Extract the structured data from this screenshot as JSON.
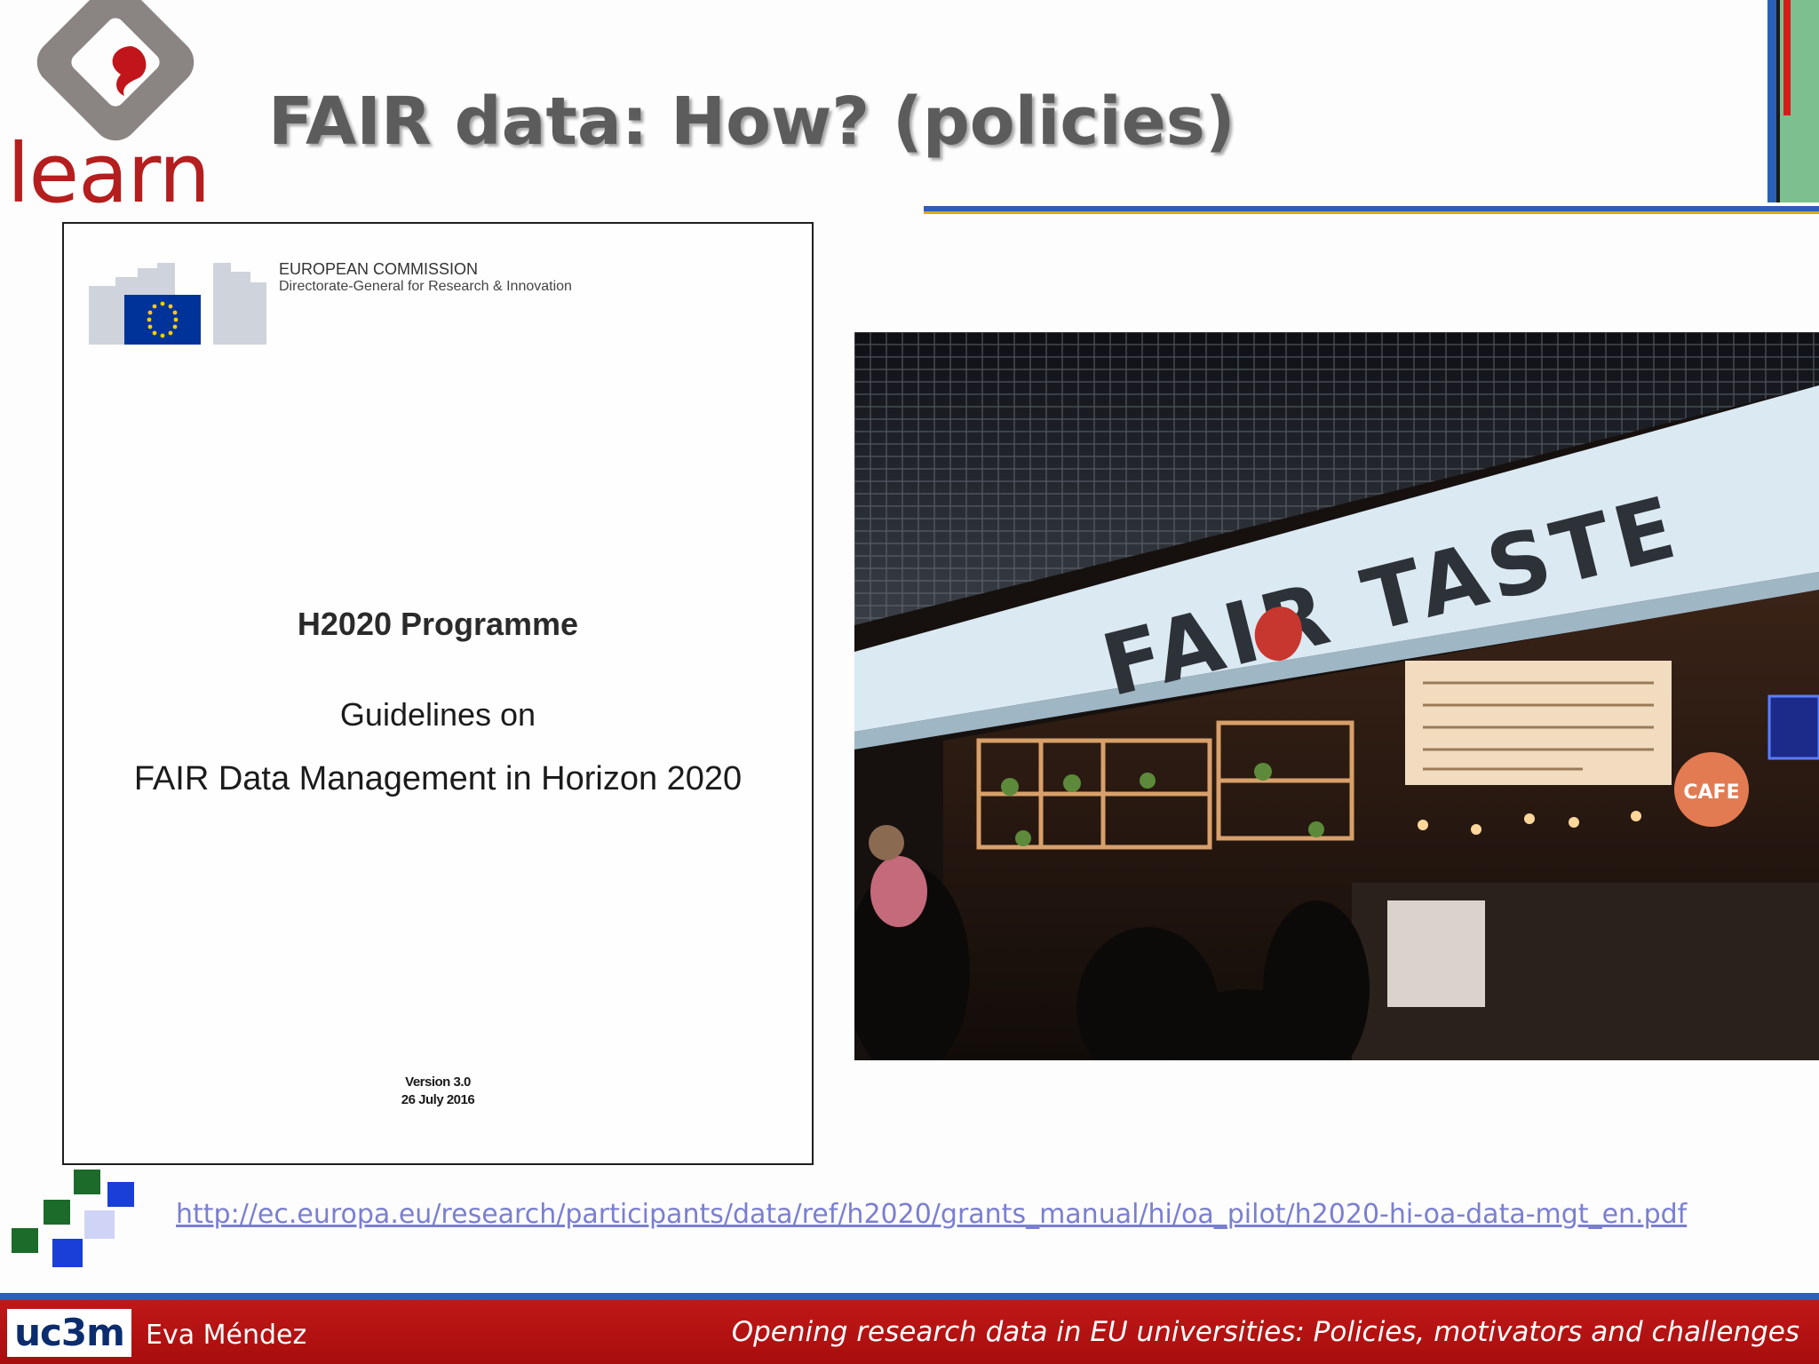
{
  "header": {
    "logo_text": "learn",
    "title": "FAIR data: How? (policies)"
  },
  "document": {
    "issuer": "EUROPEAN COMMISSION",
    "directorate": "Directorate-General for Research & Innovation",
    "programme": "H2020 Programme",
    "title_line1": "Guidelines on",
    "title_line2": "FAIR Data Management in Horizon 2020",
    "version": "Version 3.0",
    "date": "26 July 2016"
  },
  "photo": {
    "sign_text": "FAIR TASTE",
    "cafe_sign": "CAFE"
  },
  "link": {
    "url": "http://ec.europa.eu/research/participants/data/ref/h2020/grants_manual/hi/oa_pilot/h2020-hi-oa-data-mgt_en.pdf"
  },
  "footer": {
    "institution_logo": "uc3m",
    "author": "Eva Méndez",
    "talk_title": "Opening research data in EU universities: Policies, motivators and challenges"
  },
  "colors": {
    "brand_red": "#b51e1e",
    "footer_red": "#b51414",
    "accent_blue": "#2c5fb8",
    "link_color": "#7a7fd1"
  }
}
